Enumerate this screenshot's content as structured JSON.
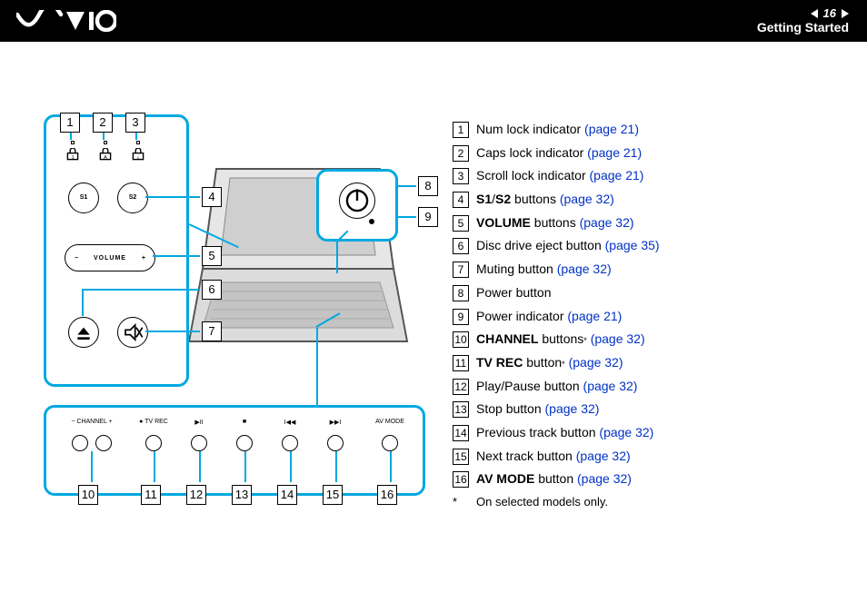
{
  "header": {
    "page_number": "16",
    "section": "Getting Started",
    "logo_alt": "VAIO"
  },
  "diagram": {
    "callouts": [
      "1",
      "2",
      "3",
      "4",
      "5",
      "6",
      "7",
      "8",
      "9",
      "10",
      "11",
      "12",
      "13",
      "14",
      "15",
      "16"
    ],
    "panel_main_labels": {
      "s1": "S1",
      "s2": "S2",
      "volume": "VOLUME",
      "minus": "−",
      "plus": "+"
    },
    "panel_bottom_labels": {
      "channel": "CHANNEL",
      "tvrec": "TV REC",
      "avmode": "AV MODE",
      "minus": "−",
      "plus": "+",
      "rec_dot": "●",
      "playpause": "▶II",
      "stop": "■",
      "prev": "I◀◀",
      "next": "▶▶I"
    }
  },
  "legend": [
    {
      "n": "1",
      "segments": [
        {
          "t": "Num lock indicator ",
          "b": false
        },
        {
          "t": "(page 21)",
          "link": true
        }
      ]
    },
    {
      "n": "2",
      "segments": [
        {
          "t": "Caps lock indicator ",
          "b": false
        },
        {
          "t": "(page 21)",
          "link": true
        }
      ]
    },
    {
      "n": "3",
      "segments": [
        {
          "t": "Scroll lock indicator ",
          "b": false
        },
        {
          "t": "(page 21)",
          "link": true
        }
      ]
    },
    {
      "n": "4",
      "segments": [
        {
          "t": "S1",
          "b": true
        },
        {
          "t": "/",
          "b": false
        },
        {
          "t": "S2",
          "b": true
        },
        {
          "t": " buttons ",
          "b": false
        },
        {
          "t": "(page 32)",
          "link": true
        }
      ]
    },
    {
      "n": "5",
      "segments": [
        {
          "t": "VOLUME",
          "b": true
        },
        {
          "t": " buttons ",
          "b": false
        },
        {
          "t": "(page 32)",
          "link": true
        }
      ]
    },
    {
      "n": "6",
      "segments": [
        {
          "t": "Disc drive eject button ",
          "b": false
        },
        {
          "t": "(page 35)",
          "link": true
        }
      ]
    },
    {
      "n": "7",
      "segments": [
        {
          "t": "Muting button ",
          "b": false
        },
        {
          "t": "(page 32)",
          "link": true
        }
      ]
    },
    {
      "n": "8",
      "segments": [
        {
          "t": "Power button",
          "b": false
        }
      ]
    },
    {
      "n": "9",
      "segments": [
        {
          "t": "Power indicator ",
          "b": false
        },
        {
          "t": "(page 21)",
          "link": true
        }
      ]
    },
    {
      "n": "10",
      "segments": [
        {
          "t": "CHANNEL",
          "b": true
        },
        {
          "t": " buttons",
          "b": false
        },
        {
          "t": "*",
          "sup": true
        },
        {
          "t": " ",
          "b": false
        },
        {
          "t": "(page 32)",
          "link": true
        }
      ]
    },
    {
      "n": "11",
      "segments": [
        {
          "t": "TV REC",
          "b": true
        },
        {
          "t": " button",
          "b": false
        },
        {
          "t": "*",
          "sup": true
        },
        {
          "t": " ",
          "b": false
        },
        {
          "t": "(page 32)",
          "link": true
        }
      ]
    },
    {
      "n": "12",
      "segments": [
        {
          "t": "Play/Pause button ",
          "b": false
        },
        {
          "t": "(page 32)",
          "link": true
        }
      ]
    },
    {
      "n": "13",
      "segments": [
        {
          "t": "Stop button ",
          "b": false
        },
        {
          "t": "(page 32)",
          "link": true
        }
      ]
    },
    {
      "n": "14",
      "segments": [
        {
          "t": "Previous track button ",
          "b": false
        },
        {
          "t": "(page 32)",
          "link": true
        }
      ]
    },
    {
      "n": "15",
      "segments": [
        {
          "t": "Next track button ",
          "b": false
        },
        {
          "t": "(page 32)",
          "link": true
        }
      ]
    },
    {
      "n": "16",
      "segments": [
        {
          "t": "AV MODE",
          "b": true
        },
        {
          "t": " button ",
          "b": false
        },
        {
          "t": "(page 32)",
          "link": true
        }
      ]
    }
  ],
  "footnote": {
    "mark": "*",
    "text": "On selected models only."
  }
}
